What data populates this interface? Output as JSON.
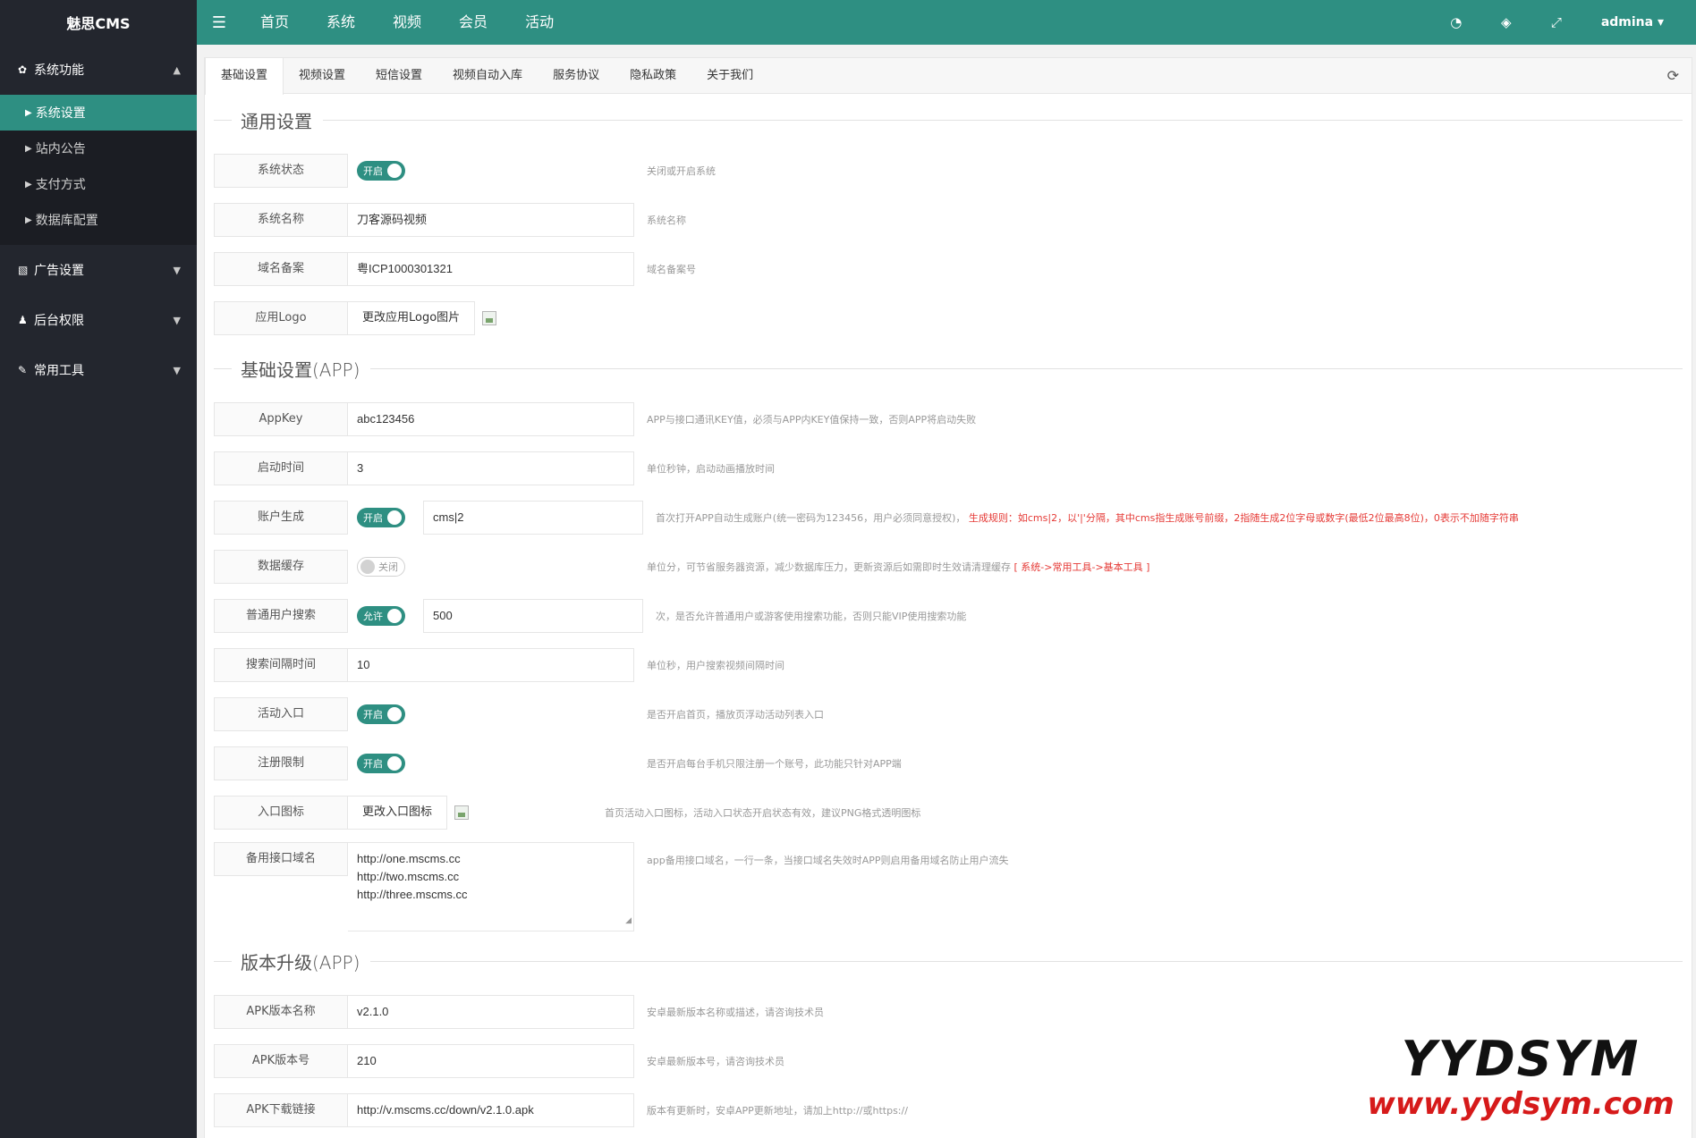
{
  "header": {
    "logo": "魅思CMS",
    "menu_icon": "☰",
    "nav": [
      "首页",
      "系统",
      "视频",
      "会员",
      "活动"
    ],
    "user": "admina ▾"
  },
  "sidebar": {
    "groups": [
      {
        "icon": "gear-icon",
        "glyph": "✿",
        "label": "系统功能",
        "caret": "▲",
        "items": [
          "系统设置",
          "站内公告",
          "支付方式",
          "数据库配置"
        ]
      },
      {
        "icon": "image-icon",
        "glyph": "▧",
        "label": "广告设置",
        "caret": "▼"
      },
      {
        "icon": "user-icon",
        "glyph": "♟",
        "label": "后台权限",
        "caret": "▼"
      },
      {
        "icon": "wrench-icon",
        "glyph": "✎",
        "label": "常用工具",
        "caret": "▼"
      }
    ],
    "item_marker": "▶"
  },
  "tabs": [
    "基础设置",
    "视频设置",
    "短信设置",
    "视频自动入库",
    "服务协议",
    "隐私政策",
    "关于我们"
  ],
  "sections": {
    "general": {
      "title": "通用设置",
      "status": {
        "label": "系统状态",
        "switch": "开启",
        "hint": "关闭或开启系统"
      },
      "name": {
        "label": "系统名称",
        "value": "刀客源码视频",
        "hint": "系统名称"
      },
      "icp": {
        "label": "域名备案",
        "value": "粤ICP1000301321",
        "hint": "域名备案号"
      },
      "logo": {
        "label": "应用Logo",
        "button": "更改应用Logo图片"
      }
    },
    "app": {
      "title": "基础设置(APP)",
      "appkey": {
        "label": "AppKey",
        "value": "abc123456",
        "hint": "APP与接口通讯KEY值，必须与APP内KEY值保持一致，否则APP将启动失败"
      },
      "startup": {
        "label": "启动时间",
        "value": "3",
        "hint": "单位秒钟，启动动画播放时间"
      },
      "account": {
        "label": "账户生成",
        "switch": "开启",
        "value": "cms|2",
        "hint": "首次打开APP自动生成账户(统一密码为123456，用户必须同意授权)，",
        "hint_red": "生成规则：如cms|2，以'|'分隔，其中cms指生成账号前缀，2指随生成2位字母或数字(最低2位最高8位)，0表示不加随字符串"
      },
      "cache": {
        "label": "数据缓存",
        "switch": "关闭",
        "hint": "单位分，可节省服务器资源，减少数据库压力，更新资源后如需即时生效请清理缓存",
        "hint_red": "[ 系统->常用工具->基本工具 ]"
      },
      "search": {
        "label": "普通用户搜索",
        "switch": "允许",
        "value": "500",
        "hint": "次，是否允许普通用户或游客使用搜索功能，否则只能VIP使用搜索功能"
      },
      "search_interval": {
        "label": "搜索间隔时间",
        "value": "10",
        "hint": "单位秒，用户搜索视频间隔时间"
      },
      "activity": {
        "label": "活动入口",
        "switch": "开启",
        "hint": "是否开启首页，播放页浮动活动列表入口"
      },
      "register": {
        "label": "注册限制",
        "switch": "开启",
        "hint": "是否开启每台手机只限注册一个账号，此功能只针对APP端"
      },
      "entry_icon": {
        "label": "入口图标",
        "button": "更改入口图标",
        "hint": "首页活动入口图标，活动入口状态开启状态有效，建议PNG格式透明图标"
      },
      "backup": {
        "label": "备用接口域名",
        "lines": [
          "http://one.mscms.cc",
          "http://two.mscms.cc",
          "http://three.mscms.cc"
        ],
        "hint": "app备用接口域名，一行一条，当接口域名失效时APP则启用备用域名防止用户流失"
      }
    },
    "upgrade": {
      "title": "版本升级(APP)",
      "apk_name": {
        "label": "APK版本名称",
        "value": "v2.1.0",
        "hint": "安卓最新版本名称或描述，请咨询技术员"
      },
      "apk_code": {
        "label": "APK版本号",
        "value": "210",
        "hint": "安卓最新版本号，请咨询技术员"
      },
      "apk_url": {
        "label": "APK下载链接",
        "value": "http://v.mscms.cc/down/v2.1.0.apk",
        "hint": "版本有更新时，安卓APP更新地址，请加上http://或https://"
      }
    }
  },
  "watermark": {
    "line1": "YYDSYM",
    "line2": "www.yydsym.com"
  },
  "colors": {
    "accent": "#2e8f82",
    "sidebar": "#23262e",
    "warning": "#e53935"
  }
}
